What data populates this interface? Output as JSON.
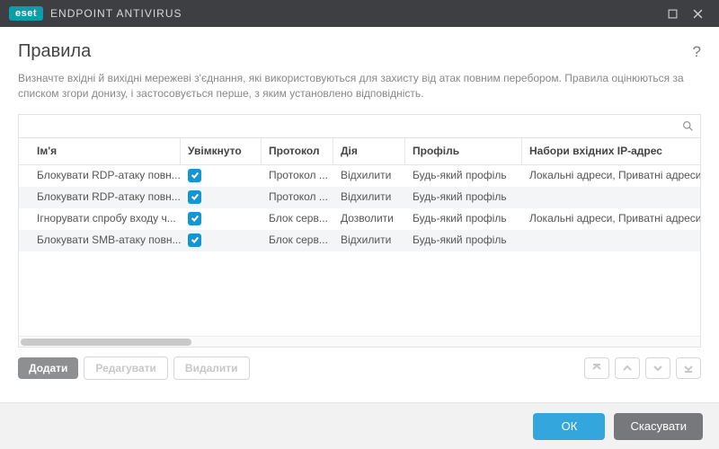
{
  "brand": {
    "badge": "eset",
    "product": "ENDPOINT ANTIVIRUS"
  },
  "page": {
    "title": "Правила",
    "description": "Визначте вхідні й вихідні мережеві з'єднання, які використовуються для захисту від атак повним перебором. Правила оцінюються за списком згори донизу, і застосовується перше, з яким установлено відповідність."
  },
  "columns": {
    "name": "Ім'я",
    "enabled": "Увімкнуто",
    "protocol": "Протокол",
    "action": "Дія",
    "profile": "Профіль",
    "ipsets": "Набори вхідних IP-адрес"
  },
  "rows": [
    {
      "name": "Блокувати RDP-атаку повн...",
      "enabled": true,
      "protocol": "Протокол ...",
      "action": "Відхилити",
      "profile": "Будь-який профіль",
      "ipsets": "Локальні адреси, Приватні адреси"
    },
    {
      "name": "Блокувати RDP-атаку повн...",
      "enabled": true,
      "protocol": "Протокол ...",
      "action": "Відхилити",
      "profile": "Будь-який профіль",
      "ipsets": ""
    },
    {
      "name": "Ігнорувати спробу входу ч...",
      "enabled": true,
      "protocol": "Блок серв...",
      "action": "Дозволити",
      "profile": "Будь-який профіль",
      "ipsets": "Локальні адреси, Приватні адреси"
    },
    {
      "name": "Блокувати SMB-атаку повн...",
      "enabled": true,
      "protocol": "Блок серв...",
      "action": "Відхилити",
      "profile": "Будь-який профіль",
      "ipsets": ""
    }
  ],
  "actions": {
    "add": "Додати",
    "edit": "Редагувати",
    "delete": "Видалити"
  },
  "footer": {
    "ok": "ОК",
    "cancel": "Скасувати"
  }
}
